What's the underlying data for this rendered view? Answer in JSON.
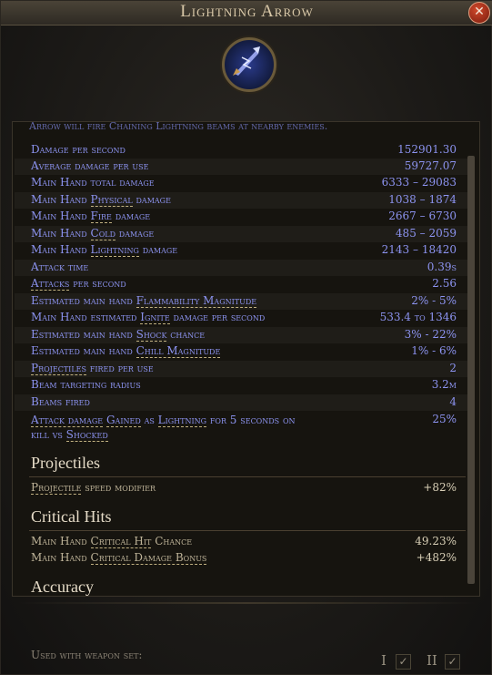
{
  "window": {
    "title": "Lightning Arrow",
    "close_glyph": "✕"
  },
  "skill_icon": "lightning-arrow-icon",
  "cut_text": "Arrow will fire Chaining Lightning beams at nearby enemies.",
  "stats": [
    {
      "label": "Damage per second",
      "value": "152901.30"
    },
    {
      "label": "Average damage per use",
      "value": "59727.07"
    },
    {
      "label": "Main Hand total damage",
      "value": "6333 – 29083"
    },
    {
      "pre": "Main Hand ",
      "link": "Physical",
      "post": " damage",
      "value": "1038 – 1874"
    },
    {
      "pre": "Main Hand ",
      "link": "Fire",
      "post": " damage",
      "value": "2667 – 6730"
    },
    {
      "pre": "Main Hand ",
      "link": "Cold",
      "post": " damage",
      "value": "485 – 2059"
    },
    {
      "pre": "Main Hand ",
      "link": "Lightning",
      "post": " damage",
      "value": "2143 – 18420"
    },
    {
      "label": "Attack time",
      "value": "0.39s"
    },
    {
      "pre": "",
      "link": "Attacks",
      "post": " per second",
      "value": "2.56"
    },
    {
      "pre": "Estimated main hand ",
      "link": "Flammability Magnitude",
      "post": "",
      "value": "2% - 5%"
    },
    {
      "pre": "Main Hand estimated ",
      "link": "Ignite",
      "post": " damage per second",
      "value": "533.4 to 1346"
    },
    {
      "pre": "Estimated main hand ",
      "link": "Shock",
      "post": " chance",
      "value": "3% - 22%"
    },
    {
      "pre": "Estimated main hand ",
      "link": "Chill Magnitude",
      "post": "",
      "value": "1% - 6%"
    },
    {
      "pre": "",
      "link": "Projectiles",
      "post": " fired per use",
      "value": "2"
    },
    {
      "label": "Beam targeting radius",
      "value": "3.2m"
    },
    {
      "label": "Beams fired",
      "value": "4"
    }
  ],
  "multi": {
    "pre": "",
    "link1": "Attack damage",
    "mid1": " ",
    "link2": "Gained",
    "mid2": " as ",
    "link3": "Lightning",
    "line1_post": " for 5 seconds on",
    "line2_pre": "kill vs ",
    "link4": "Shocked",
    "value": "25%"
  },
  "sections": [
    {
      "title": "Projectiles",
      "rows": [
        {
          "link": "Projectile",
          "post": " speed modifier",
          "value": "+82%"
        }
      ]
    },
    {
      "title": "Critical Hits",
      "rows": [
        {
          "pre": "Main Hand ",
          "link": "Critical Hit",
          "post": " Chance",
          "value": "49.23%"
        },
        {
          "pre": "Main Hand ",
          "link": "Critical Damage Bonus",
          "post": "",
          "value": "+482%"
        }
      ]
    },
    {
      "title": "Accuracy"
    }
  ],
  "footer": {
    "label": "Used with weapon set:",
    "set1": "I",
    "set2": "II",
    "check": "✓"
  },
  "colors": {
    "stat_text": "#8c93f0",
    "header_text": "#e6dcc8",
    "accent_underline": "#c0b080"
  }
}
